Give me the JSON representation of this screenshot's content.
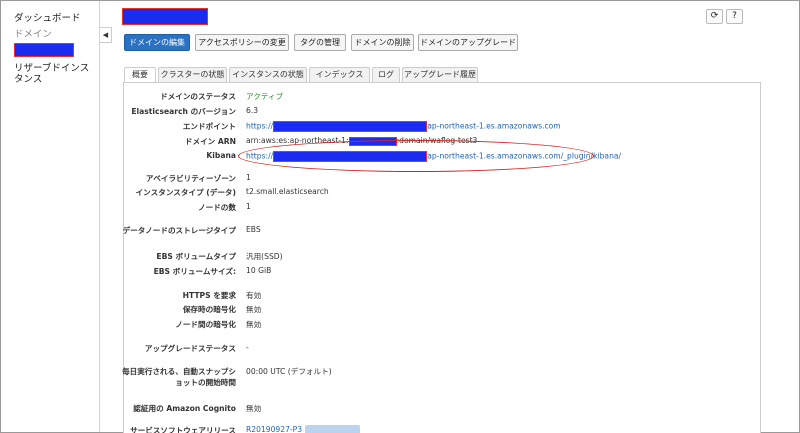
{
  "sidebar": {
    "items": [
      {
        "label": "ダッシュボード"
      },
      {
        "label": "ドメイン"
      },
      {
        "label": "リザーブドインスタンス"
      }
    ],
    "collapse_glyph": "◀"
  },
  "header": {
    "refresh_glyph": "⟳",
    "help_glyph": "?"
  },
  "actions": [
    {
      "label": "ドメインの編集"
    },
    {
      "label": "アクセスポリシーの変更"
    },
    {
      "label": "タグの管理"
    },
    {
      "label": "ドメインの削除"
    },
    {
      "label": "ドメインのアップグレード"
    }
  ],
  "tabs": [
    {
      "label": "概要"
    },
    {
      "label": "クラスターの状態"
    },
    {
      "label": "インスタンスの状態"
    },
    {
      "label": "インデックス"
    },
    {
      "label": "ログ"
    },
    {
      "label": "アップグレード履歴"
    }
  ],
  "overview": {
    "domain_status_label": "ドメインのステータス",
    "domain_status": "アクティブ",
    "es_version_label": "Elasticsearch のバージョン",
    "es_version": "6.3",
    "endpoint_label": "エンドポイント",
    "endpoint_prefix": "https://",
    "endpoint_suffix": "ap-northeast-1.es.amazonaws.com",
    "arn_label": "ドメイン ARN",
    "arn_prefix": "arn:aws:es:ap-northeast-1:",
    "arn_suffix": ":domain/waflog-test3",
    "kibana_label": "Kibana",
    "kibana_prefix": "https://",
    "kibana_suffix": "ap-northeast-1.es.amazonaws.com/_plugin/kibana/",
    "az_label": "アベイラビリティーゾーン",
    "az": "1",
    "instance_type_label": "インスタンスタイプ (データ)",
    "instance_type": "t2.small.elasticsearch",
    "node_count_label": "ノードの数",
    "node_count": "1",
    "storage_type_label": "データノードのストレージタイプ",
    "storage_type": "EBS",
    "ebs_volume_type_label": "EBS ボリュームタイプ",
    "ebs_volume_type": "汎用(SSD)",
    "ebs_volume_size_label": "EBS ボリュームサイズ:",
    "ebs_volume_size": "10 GiB",
    "https_label": "HTTPS を要求",
    "https": "有効",
    "encrypt_rest_label": "保存時の暗号化",
    "encrypt_rest": "無効",
    "node_encrypt_label": "ノード間の暗号化",
    "node_encrypt": "無効",
    "upgrade_status_label": "アップグレードステータス",
    "upgrade_status": "-",
    "snapshot_label": "毎日実行される、自動スナップショットの開始時間",
    "snapshot": "00:00 UTC (デフォルト)",
    "cognito_label": "認証用の Amazon Cognito",
    "cognito": "無効",
    "software_label": "サービスソフトウェアリリース",
    "software": "R20190927-P3"
  },
  "colors": {
    "primary": "#2b72c3",
    "link": "#2463b8",
    "active_green": "#2e8b2e",
    "redaction": "#1b2cf0",
    "annotation_red": "#d0261f"
  }
}
